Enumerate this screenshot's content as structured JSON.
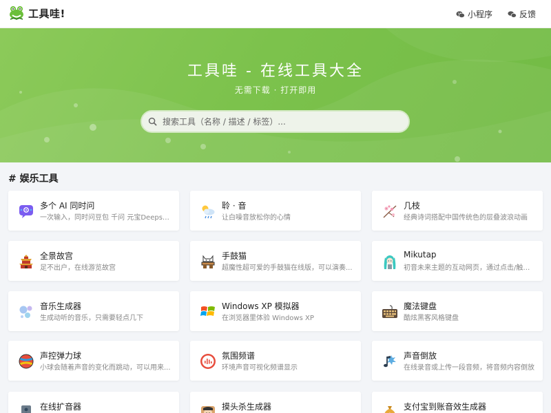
{
  "header": {
    "logo_text": "工具哇!",
    "nav": [
      {
        "label": "小程序",
        "icon": "wechat-icon"
      },
      {
        "label": "反馈",
        "icon": "chat-bubbles-icon"
      }
    ]
  },
  "hero": {
    "title": "工具哇 - 在线工具大全",
    "subtitle": "无需下载 · 打开即用",
    "search_placeholder": "搜索工具（名称 / 描述 / 标签）..."
  },
  "section": {
    "title": "# 娱乐工具"
  },
  "tools": [
    {
      "name": "多个 AI 同时问",
      "desc": "一次输入，同时问豆包 千问 元宝Deepseek...",
      "icon": "ai-chat-icon"
    },
    {
      "name": "聆 · 音",
      "desc": "让白噪音放松你的心情",
      "icon": "weather-rain-icon"
    },
    {
      "name": "几枝",
      "desc": "经典诗词搭配中国传统色的层叠波浪动画",
      "icon": "plum-blossom-icon"
    },
    {
      "name": "全景故宫",
      "desc": "足不出户，在线游览故宫",
      "icon": "palace-icon"
    },
    {
      "name": "手鼓猫",
      "desc": "超魔性超可爱的手鼓猫在线版，可以演奏...",
      "icon": "bongo-cat-icon"
    },
    {
      "name": "Mikutap",
      "desc": "初音未来主题的互动网页，通过点击/触摸...",
      "icon": "miku-icon"
    },
    {
      "name": "音乐生成器",
      "desc": "生成动听的音乐，只需要轻点几下",
      "icon": "music-dots-icon"
    },
    {
      "name": "Windows XP 模拟器",
      "desc": "在浏览器里体验 Windows XP",
      "icon": "windows-logo-icon"
    },
    {
      "name": "魔法键盘",
      "desc": "酷炫黑客风格键盘",
      "icon": "keyboard-icon"
    },
    {
      "name": "声控弹力球",
      "desc": "小球会随着声音的变化而跳动，可以用来...",
      "icon": "ball-icon"
    },
    {
      "name": "氛围频谱",
      "desc": "环境声音可视化频谱显示",
      "icon": "spectrum-icon"
    },
    {
      "name": "声音倒放",
      "desc": "在线录音或上传一段音频，将音频内容倒放",
      "icon": "music-note-icon"
    },
    {
      "name": "在线扩音器",
      "desc": "",
      "icon": "speaker-icon"
    },
    {
      "name": "摸头杀生成器",
      "desc": "",
      "icon": "pat-head-icon"
    },
    {
      "name": "支付宝到账音效生成器",
      "desc": "",
      "icon": "money-bag-icon"
    }
  ],
  "colors": {
    "hero_green": "#7cc24c",
    "background": "#f3f5f8"
  }
}
